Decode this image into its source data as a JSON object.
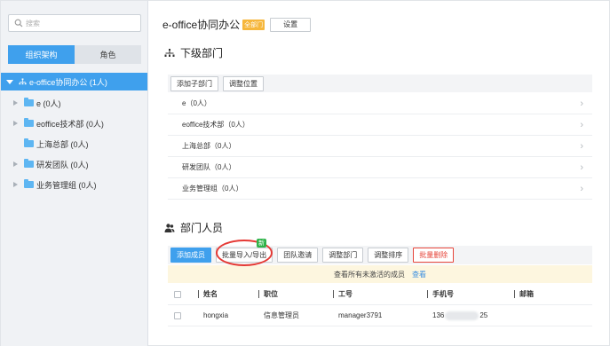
{
  "sidebar": {
    "search_placeholder": "搜索",
    "tabs": [
      {
        "label": "组织架构",
        "active": true
      },
      {
        "label": "角色",
        "active": false
      }
    ],
    "tree_root": "e-office协同办公 (1人)",
    "tree_nodes": [
      {
        "label": "e (0人)",
        "has_children": true
      },
      {
        "label": "eoffice技术部 (0人)",
        "has_children": true
      },
      {
        "label": "上海总部 (0人)",
        "has_children": false
      },
      {
        "label": "研发团队 (0人)",
        "has_children": true
      },
      {
        "label": "业务管理组 (0人)",
        "has_children": true
      }
    ]
  },
  "main": {
    "title": "e-office协同办公",
    "badge": "全部门",
    "settings_label": "设置",
    "sub_section_title": "下级部门",
    "sub_toolbar": {
      "add_sub_label": "添加子部门",
      "adjust_position_label": "调整位置"
    },
    "sub_departments": [
      "e（0人）",
      "eoffice技术部（0人）",
      "上海总部（0人）",
      "研发团队（0人）",
      "业务管理组（0人）"
    ],
    "member_section_title": "部门人员",
    "member_toolbar": {
      "add_member": "添加成员",
      "batch_import_export": "批量导入/导出",
      "team_invite": "团队邀请",
      "adjust_department": "调整部门",
      "adjust_order": "调整排序",
      "batch_delete": "批量删除"
    },
    "new_tag": "新",
    "notice": {
      "text": "查看所有未激活的成员",
      "link": "查看"
    },
    "table": {
      "headers": [
        "姓名",
        "职位",
        "工号",
        "手机号",
        "邮箱"
      ],
      "rows": [
        {
          "name": "hongxia",
          "position": "信息管理员",
          "employee_id": "manager3791",
          "phone_prefix": "136",
          "phone_suffix": "25",
          "email": ""
        }
      ]
    }
  },
  "colors": {
    "accent": "#3fa0ed",
    "danger": "#e6453a",
    "highlight_circle": "#e53935",
    "notice_bg": "#fdf6df"
  }
}
